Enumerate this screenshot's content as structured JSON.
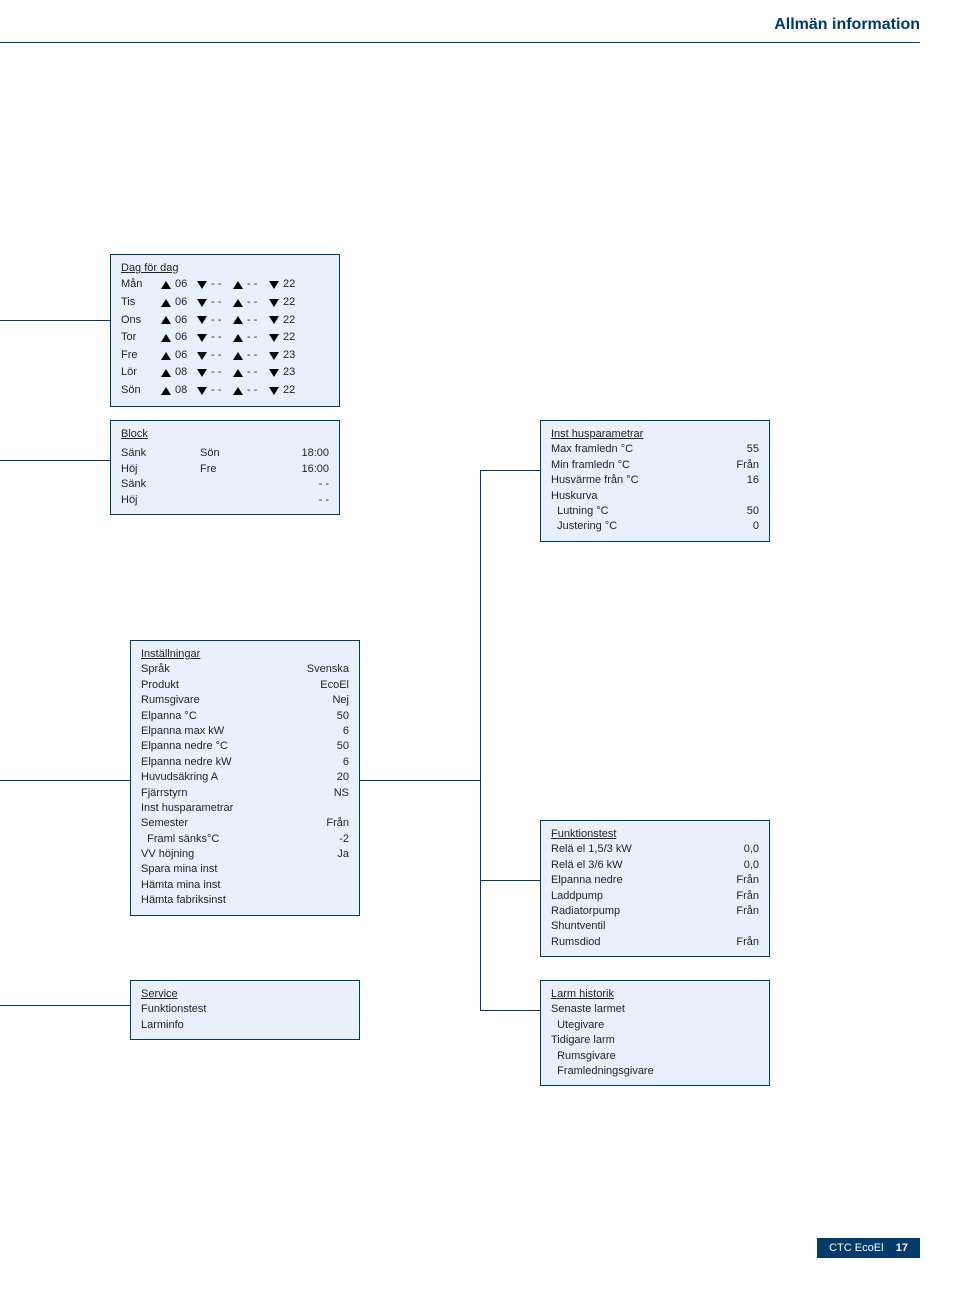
{
  "header": {
    "title": "Allmän information"
  },
  "dagForDag": {
    "title": "Dag för dag",
    "rows": [
      {
        "day": "Mån",
        "a": "06",
        "b": "- -",
        "c": "- -",
        "d": "22"
      },
      {
        "day": "Tis",
        "a": "06",
        "b": "- -",
        "c": "- -",
        "d": "22"
      },
      {
        "day": "Ons",
        "a": "06",
        "b": "- -",
        "c": "- -",
        "d": "22"
      },
      {
        "day": "Tor",
        "a": "06",
        "b": "- -",
        "c": "- -",
        "d": "22"
      },
      {
        "day": "Fre",
        "a": "06",
        "b": "- -",
        "c": "- -",
        "d": "23"
      },
      {
        "day": "Lör",
        "a": "08",
        "b": "- -",
        "c": "- -",
        "d": "23"
      },
      {
        "day": "Sön",
        "a": "08",
        "b": "- -",
        "c": "- -",
        "d": "22"
      }
    ]
  },
  "block": {
    "title": "Block",
    "rows": [
      {
        "l": "Sänk",
        "m": "Sön",
        "r": "18:00"
      },
      {
        "l": "Höj",
        "m": "Fre",
        "r": "16:00"
      },
      {
        "l": "Sänk",
        "m": "",
        "r": "- -"
      },
      {
        "l": "Höj",
        "m": "",
        "r": "- -"
      }
    ]
  },
  "instHus": {
    "title": "Inst husparametrar",
    "rows": [
      {
        "l": "Max framledn °C",
        "r": "55"
      },
      {
        "l": "Min framledn °C",
        "r": "Från"
      },
      {
        "l": "Husvärme från °C",
        "r": "16"
      },
      {
        "l": "Huskurva",
        "r": ""
      },
      {
        "l": "  Lutning °C",
        "r": "50"
      },
      {
        "l": "  Justering °C",
        "r": "0"
      }
    ]
  },
  "installningar": {
    "title": "Inställningar",
    "rows": [
      {
        "l": "Språk",
        "r": "Svenska"
      },
      {
        "l": "Produkt",
        "r": "EcoEl"
      },
      {
        "l": "Rumsgivare",
        "r": "Nej"
      },
      {
        "l": "Elpanna °C",
        "r": "50"
      },
      {
        "l": "Elpanna max kW",
        "r": "6"
      },
      {
        "l": "Elpanna nedre °C",
        "r": "50"
      },
      {
        "l": "Elpanna nedre kW",
        "r": "6"
      },
      {
        "l": "Huvudsäkring A",
        "r": "20"
      },
      {
        "l": "Fjärrstyrn",
        "r": "NS"
      },
      {
        "l": "Inst husparametrar",
        "r": ""
      },
      {
        "l": "Semester",
        "r": "Från"
      },
      {
        "l": "  Framl sänks°C",
        "r": "-2"
      },
      {
        "l": "VV höjning",
        "r": "Ja"
      },
      {
        "l": "Spara mina inst",
        "r": ""
      },
      {
        "l": "Hämta mina inst",
        "r": ""
      },
      {
        "l": "Hämta fabriksinst",
        "r": ""
      }
    ]
  },
  "funktionstest": {
    "title": "Funktionstest",
    "rows": [
      {
        "l": "Relä el 1,5/3 kW",
        "r": "0,0"
      },
      {
        "l": "Relä el 3/6 kW",
        "r": "0,0"
      },
      {
        "l": "Elpanna nedre",
        "r": "Från"
      },
      {
        "l": "Laddpump",
        "r": "Från"
      },
      {
        "l": "Radiatorpump",
        "r": "Från"
      },
      {
        "l": "Shuntventil",
        "r": ""
      },
      {
        "l": "Rumsdiod",
        "r": "Från"
      }
    ]
  },
  "service": {
    "title": "Service",
    "lines": [
      "Funktionstest",
      "Larminfo"
    ]
  },
  "larmHistorik": {
    "title": "Larm historik",
    "lines": [
      "Senaste larmet",
      "  Utegivare",
      "Tidigare larm",
      "  Rumsgivare",
      "  Framledningsgivare"
    ]
  },
  "footer": {
    "product": "CTC EcoEl",
    "page": "17"
  }
}
